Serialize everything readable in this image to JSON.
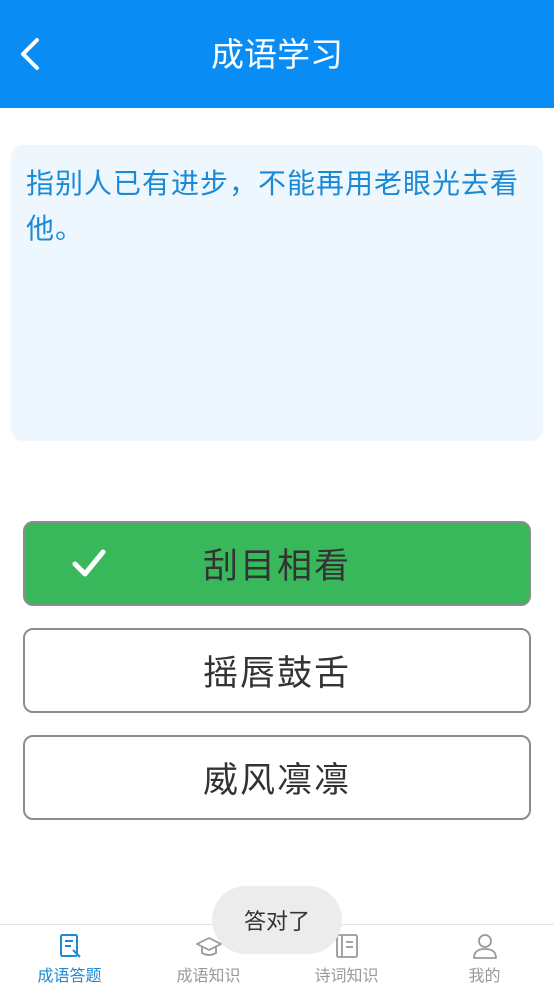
{
  "header": {
    "title": "成语学习"
  },
  "question": {
    "text": "指别人已有进步，不能再用老眼光去看他。"
  },
  "options": [
    {
      "label": "刮目相看",
      "state": "correct"
    },
    {
      "label": "摇唇鼓舌",
      "state": "default"
    },
    {
      "label": "威风凛凛",
      "state": "default"
    }
  ],
  "toast": {
    "text": "答对了"
  },
  "tabbar": {
    "items": [
      {
        "label": "成语答题",
        "icon": "quiz-icon",
        "active": true
      },
      {
        "label": "成语知识",
        "icon": "graduation-cap-icon",
        "active": false
      },
      {
        "label": "诗词知识",
        "icon": "book-icon",
        "active": false
      },
      {
        "label": "我的",
        "icon": "user-icon",
        "active": false
      }
    ]
  },
  "colors": {
    "primary": "#0a8cf5",
    "question_text": "#1a8ad6",
    "question_bg": "#eef6fe",
    "correct": "#39b85b",
    "tab_active": "#1a8ad6",
    "tab_inactive": "#999999"
  }
}
